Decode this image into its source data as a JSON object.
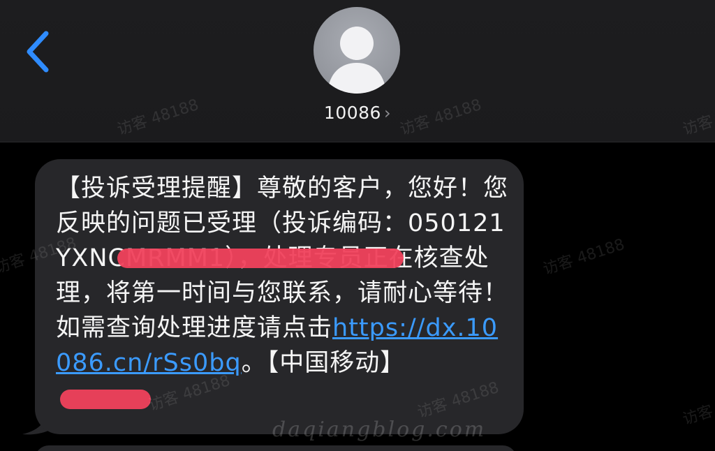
{
  "header": {
    "contact_name": "10086",
    "chevron": "›"
  },
  "message": {
    "text_before_link": "【投诉受理提醒】尊敬的客户，您好！您反映的问题已受理（投诉编码：050121YXNCMRMM1），处理专员正在核查处理，将第一时间与您联系，请耐心等待！如需查询处理进度请点击",
    "link_text": "https://dx.10086.cn/rSs0bq",
    "text_after_link": "。【中国移动】"
  },
  "watermarks": {
    "visitor": "访客 48188",
    "blog": "daqiangblog.com"
  },
  "colors": {
    "accent_blue": "#2f8cff",
    "bubble": "#27272a",
    "redaction": "#f0415c"
  },
  "icons": [
    "back-chevron-icon",
    "avatar-person-icon",
    "chevron-right-icon"
  ]
}
